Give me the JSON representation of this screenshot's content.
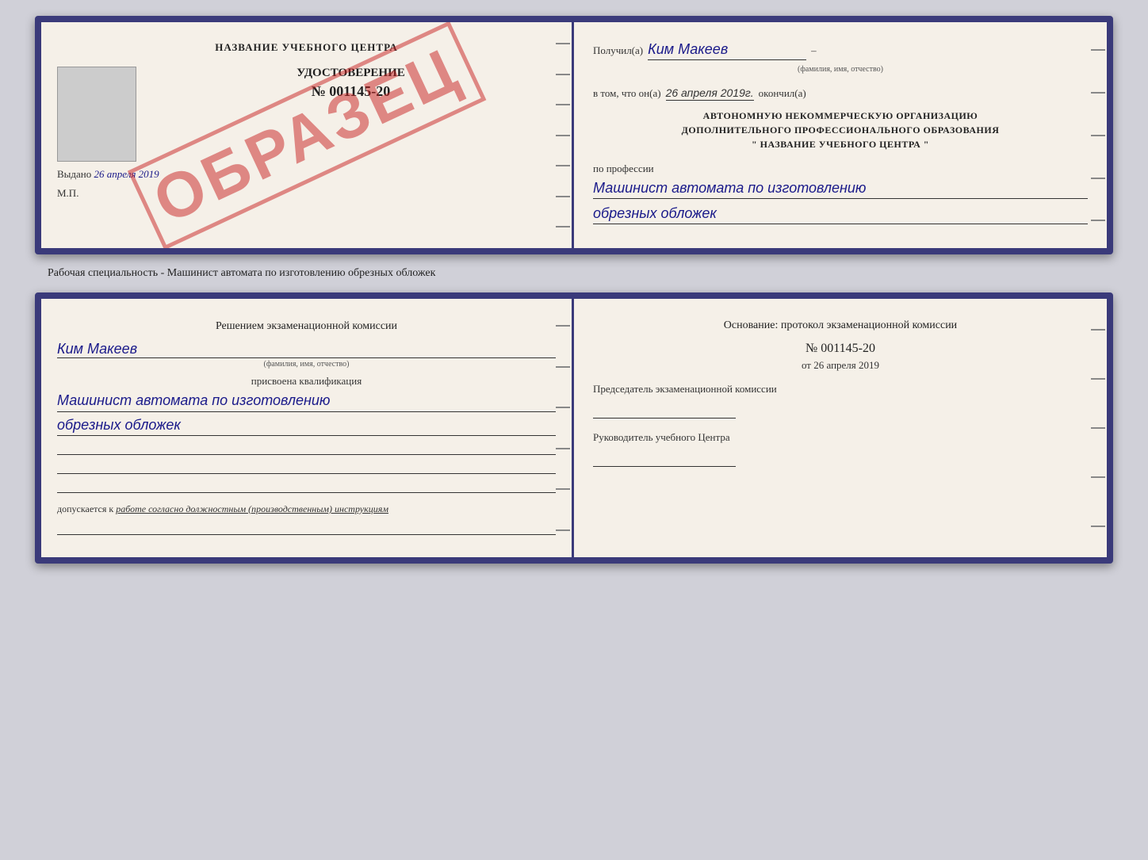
{
  "page": {
    "background": "#d0d0d8"
  },
  "doc1": {
    "left": {
      "title": "НАЗВАНИЕ УЧЕБНОГО ЦЕНТРА",
      "cert_label": "УДОСТОВЕРЕНИЕ",
      "cert_number": "№ 001145-20",
      "issued_label": "Выдано",
      "issued_date": "26 апреля 2019",
      "mp_label": "М.П.",
      "watermark": "ОБРАЗЕЦ"
    },
    "right": {
      "recv_prefix": "Получил(а)",
      "recv_name": "Ким Макеев",
      "recv_subtext": "(фамилия, имя, отчество)",
      "date_prefix": "в том, что он(а)",
      "date_value": "26 апреля 2019г.",
      "date_suffix": "окончил(а)",
      "institution_lines": [
        "АВТОНОМНУЮ НЕКОММЕРЧЕСКУЮ ОРГАНИЗАЦИЮ",
        "ДОПОЛНИТЕЛЬНОГО ПРОФЕССИОНАЛЬНОГО ОБРАЗОВАНИЯ",
        "\"  НАЗВАНИЕ УЧЕБНОГО ЦЕНТРА  \""
      ],
      "profession_label": "по профессии",
      "profession_line1": "Машинист автомата по изготовлению",
      "profession_line2": "обрезных обложек"
    }
  },
  "caption": "Рабочая специальность - Машинист автомата по изготовлению обрезных обложек",
  "doc2": {
    "left": {
      "decision_text": "Решением экзаменационной комиссии",
      "person_name": "Ким Макеев",
      "person_subtext": "(фамилия, имя, отчество)",
      "assigned_label": "присвоена квалификация",
      "qualif_line1": "Машинист автомата по изготовлению",
      "qualif_line2": "обрезных обложек",
      "allowed_prefix": "допускается к",
      "allowed_text": "работе согласно должностным (производственным) инструкциям"
    },
    "right": {
      "basis_label": "Основание: протокол экзаменационной комиссии",
      "protocol_num": "№  001145-20",
      "protocol_date_prefix": "от",
      "protocol_date": "26 апреля 2019",
      "chair_label": "Председатель экзаменационной комиссии",
      "head_label": "Руководитель учебного Центра"
    }
  }
}
